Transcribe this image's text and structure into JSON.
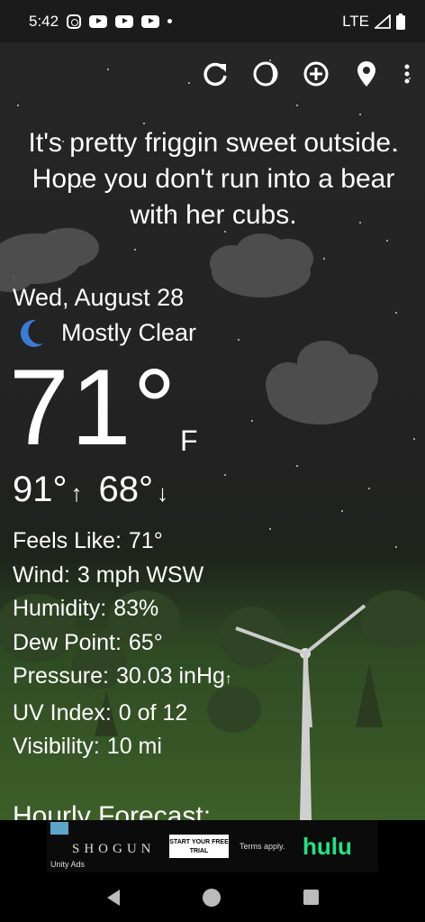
{
  "status_bar": {
    "time": "5:42",
    "network": "LTE"
  },
  "quote": "It's pretty friggin sweet outside. Hope you don't run into a bear with her cubs.",
  "date": "Wed, August 28",
  "condition": "Mostly Clear",
  "current": {
    "temp": "71°",
    "unit": "F"
  },
  "hi_lo": {
    "high": "91°",
    "low": "68°"
  },
  "details": [
    {
      "label": "Feels Like:",
      "value": "71°"
    },
    {
      "label": "Wind:",
      "value": "3 mph WSW"
    },
    {
      "label": "Humidity:",
      "value": "83%"
    },
    {
      "label": "Dew Point:",
      "value": "65°"
    },
    {
      "label": "Pressure:",
      "value": "30.03 inHg"
    },
    {
      "label": "UV Index:",
      "value": "0 of 12"
    },
    {
      "label": "Visibility:",
      "value": "10 mi"
    }
  ],
  "hourly_heading": "Hourly Forecast:",
  "ad": {
    "brand": "SHOGUN",
    "network": "Unity Ads",
    "cta": "START YOUR FREE TRIAL",
    "terms": "Terms apply.",
    "service": "hulu"
  },
  "icons": [
    "refresh-icon",
    "moon-phase-icon",
    "add-location-icon",
    "location-pin-icon",
    "more-vert-icon",
    "moon-icon"
  ]
}
